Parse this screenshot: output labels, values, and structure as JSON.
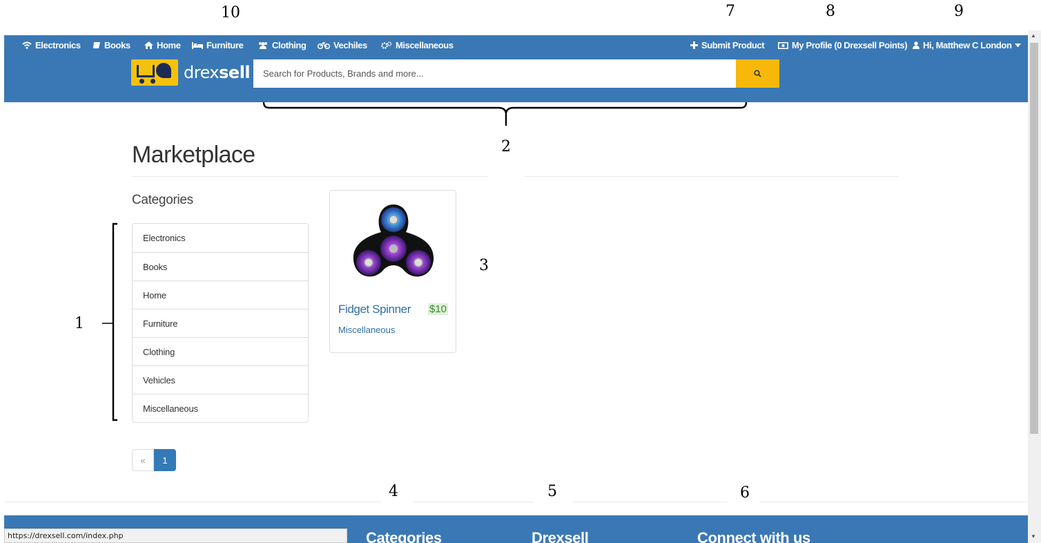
{
  "annotations": [
    "1",
    "2",
    "3",
    "4",
    "5",
    "6",
    "7",
    "8",
    "9",
    "10"
  ],
  "nav": {
    "left_items": [
      {
        "label": "Electronics",
        "icon": "wifi-icon"
      },
      {
        "label": "Books",
        "icon": "book-icon"
      },
      {
        "label": "Home",
        "icon": "home-icon"
      },
      {
        "label": "Furniture",
        "icon": "bed-icon"
      },
      {
        "label": "Clothing",
        "icon": "users-icon"
      },
      {
        "label": "Vechiles",
        "icon": "bicycle-icon"
      },
      {
        "label": "Miscellaneous",
        "icon": "cogs-icon"
      }
    ],
    "submit_product": "Submit Product",
    "my_profile": "My Profile (0 Drexsell Points)",
    "user_greeting": "Hi, Matthew C London"
  },
  "brand": {
    "light": "drex",
    "bold": "sell"
  },
  "search": {
    "placeholder": "Search for Products, Brands and more..."
  },
  "page": {
    "title": "Marketplace"
  },
  "categories": {
    "heading": "Categories",
    "items": [
      "Electronics",
      "Books",
      "Home",
      "Furniture",
      "Clothing",
      "Vehicles",
      "Miscellaneous"
    ]
  },
  "product": {
    "name": "Fidget Spinner",
    "price": "$10",
    "category": "Miscellaneous"
  },
  "pagination": {
    "prev": "«",
    "current": "1"
  },
  "footer": {
    "col1": "Categories",
    "col2": "Drexsell",
    "col3": "Connect with us"
  },
  "status_bar": {
    "url": "https://drexsell.com/index.php"
  },
  "colors": {
    "navbar": "#3a78b5",
    "accent": "#f7b80a",
    "link": "#2f6ea5",
    "price_bg": "#dff0d8"
  }
}
